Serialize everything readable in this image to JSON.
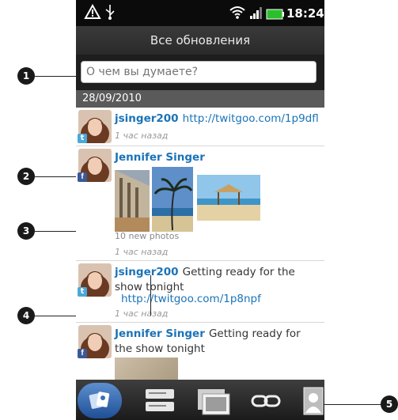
{
  "status": {
    "time": "18:24"
  },
  "header": {
    "title": "Все обновления"
  },
  "composer": {
    "placeholder": "О чем вы думаете?"
  },
  "feed": {
    "date": "28/09/2010",
    "items": [
      {
        "author": "jsinger200",
        "text": "",
        "link": "http://twitgoo.com/1p9dfl",
        "time": "1 час назад",
        "network": "twitter"
      },
      {
        "author": "Jennifer Singer",
        "photos_caption": "10 new photos",
        "time": "1 час назад",
        "network": "facebook"
      },
      {
        "author": "jsinger200",
        "text": "Getting ready for the show tonight",
        "link": "http://twitgoo.com/1p8npf",
        "time": "1 час назад",
        "network": "twitter"
      },
      {
        "author": "Jennifer Singer",
        "text": "Getting ready for the show tonight",
        "network": "facebook"
      }
    ]
  },
  "callouts": [
    "1",
    "2",
    "3",
    "4",
    "5"
  ],
  "tabs": [
    {
      "name": "tab-updates",
      "icon": "people-icon",
      "active": true
    },
    {
      "name": "tab-messages",
      "icon": "messages-icon",
      "active": false
    },
    {
      "name": "tab-photos",
      "icon": "photos-icon",
      "active": false
    },
    {
      "name": "tab-links",
      "icon": "link-icon",
      "active": false
    },
    {
      "name": "tab-profile",
      "icon": "profile-icon",
      "active": false
    }
  ],
  "colors": {
    "accent": "#1a73b8",
    "twitter": "#4aa8d8",
    "facebook": "#3b5998"
  }
}
